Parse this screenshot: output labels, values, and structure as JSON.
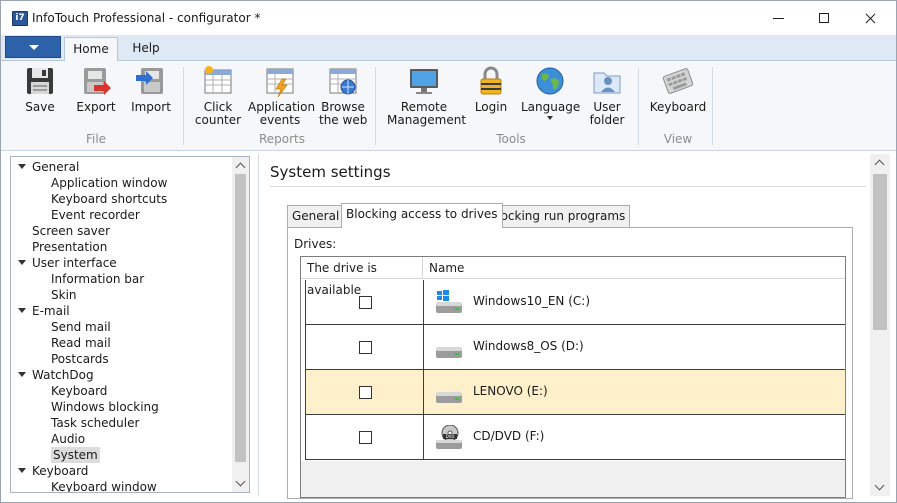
{
  "window": {
    "title": "InfoTouch Professional - configurator *",
    "icon_text": "i7"
  },
  "ribbon_tabs": [
    {
      "label": "Home",
      "active": true
    },
    {
      "label": "Help",
      "active": false
    }
  ],
  "ribbon": {
    "groups": [
      {
        "label": "File",
        "buttons": [
          {
            "line1": "Save",
            "line2": ""
          },
          {
            "line1": "Export",
            "line2": ""
          },
          {
            "line1": "Import",
            "line2": ""
          }
        ]
      },
      {
        "label": "Reports",
        "buttons": [
          {
            "line1": "Click",
            "line2": "counter"
          },
          {
            "line1": "Application",
            "line2": "events"
          },
          {
            "line1": "Browse",
            "line2": "the web"
          }
        ]
      },
      {
        "label": "Tools",
        "buttons": [
          {
            "line1": "Remote",
            "line2": "Management"
          },
          {
            "line1": "Login",
            "line2": ""
          },
          {
            "line1": "Language",
            "line2": ""
          },
          {
            "line1": "User",
            "line2": "folder"
          }
        ]
      },
      {
        "label": "View",
        "buttons": [
          {
            "line1": "Keyboard",
            "line2": ""
          }
        ]
      }
    ]
  },
  "tree": [
    {
      "label": "General",
      "level": 0,
      "expanded": true
    },
    {
      "label": "Application window",
      "level": 1
    },
    {
      "label": "Keyboard shortcuts",
      "level": 1
    },
    {
      "label": "Event recorder",
      "level": 1
    },
    {
      "label": "Screen saver",
      "level": 0
    },
    {
      "label": "Presentation",
      "level": 0
    },
    {
      "label": "User interface",
      "level": 0,
      "expanded": true
    },
    {
      "label": "Information bar",
      "level": 1
    },
    {
      "label": "Skin",
      "level": 1
    },
    {
      "label": "E-mail",
      "level": 0,
      "expanded": true
    },
    {
      "label": "Send mail",
      "level": 1
    },
    {
      "label": "Read mail",
      "level": 1
    },
    {
      "label": "Postcards",
      "level": 1
    },
    {
      "label": "WatchDog",
      "level": 0,
      "expanded": true
    },
    {
      "label": "Keyboard",
      "level": 1
    },
    {
      "label": "Windows blocking",
      "level": 1
    },
    {
      "label": "Task scheduler",
      "level": 1
    },
    {
      "label": "Audio",
      "level": 1
    },
    {
      "label": "System",
      "level": 1,
      "selected": true
    },
    {
      "label": "Keyboard",
      "level": 0,
      "expanded": true
    },
    {
      "label": "Keyboard window",
      "level": 1
    }
  ],
  "settings": {
    "title": "System settings",
    "tabs": [
      {
        "label": "General",
        "active": false
      },
      {
        "label": "Blocking access to drives",
        "active": true
      },
      {
        "label": "Blocking run programs",
        "active": false
      }
    ],
    "drives_label": "Drives:",
    "columns": [
      "The drive is available",
      "Name"
    ],
    "drives": [
      {
        "name": "Windows10_EN (C:)",
        "available": false,
        "icon": "windows-drive-icon",
        "highlighted": false
      },
      {
        "name": "Windows8_OS (D:)",
        "available": false,
        "icon": "hard-drive-icon",
        "highlighted": false
      },
      {
        "name": "LENOVO (E:)",
        "available": false,
        "icon": "hard-drive-icon",
        "highlighted": true
      },
      {
        "name": "CD/DVD (F:)",
        "available": false,
        "icon": "dvd-drive-icon",
        "highlighted": false
      }
    ]
  }
}
